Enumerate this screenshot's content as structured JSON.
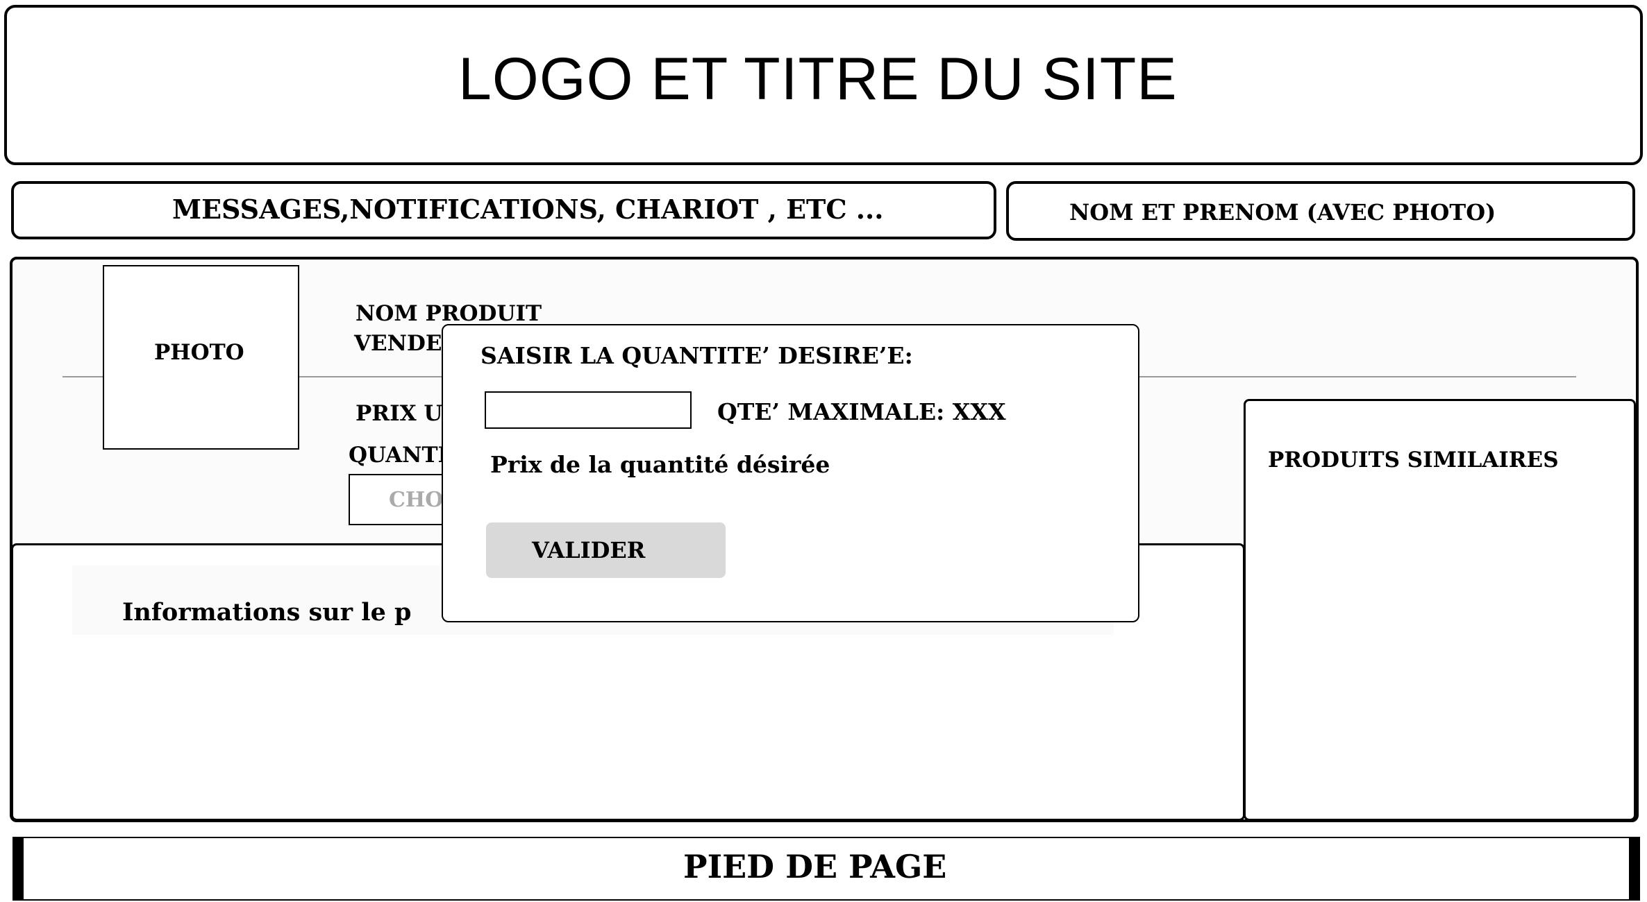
{
  "header": {
    "title": "LOGO ET TITRE DU SITE"
  },
  "nav": {
    "messages_label": "MESSAGES,NOTIFICATIONS, CHARIOT , ETC ...",
    "user_label": "NOM ET PRENOM   (AVEC PHOTO)"
  },
  "product": {
    "photo_label": "PHOTO",
    "name_label": "NOM PRODUIT",
    "seller_label": "VENDE",
    "price_label": "PRIX U",
    "quantity_label": "QUANTI",
    "choose_label": "CHO",
    "info_label": "Informations sur le p",
    "similar_label": "PRODUITS SIMILAIRES"
  },
  "modal": {
    "title": "SAISIR LA QUANTITE’ DESIRE’E:",
    "qty_input_value": "",
    "max_label": "QTE’ MAXIMALE: XXX",
    "price_label": "Prix de la quantité désirée",
    "validate_label": "VALIDER"
  },
  "footer": {
    "label": "PIED DE PAGE"
  }
}
